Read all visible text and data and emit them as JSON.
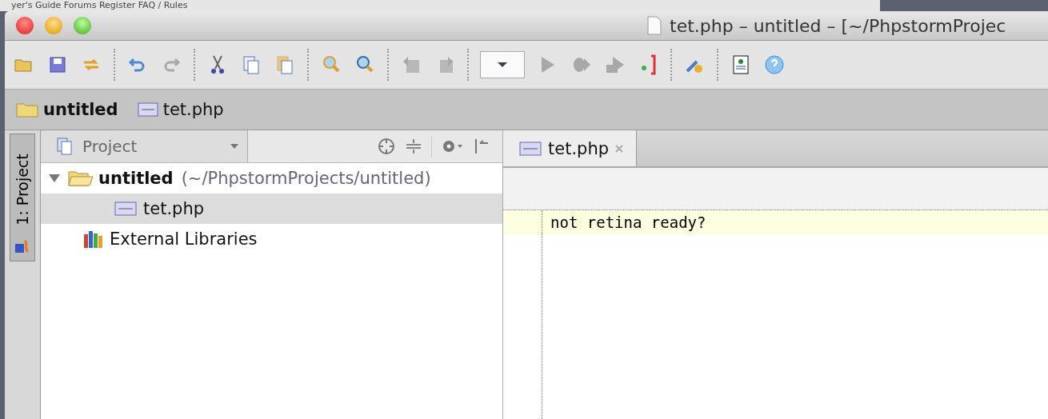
{
  "backdrop_text": "yer's Guide Forums Register FAQ / Rules",
  "window": {
    "title": "tet.php – untitled – [~/PhpstormProjec"
  },
  "toolbar": {
    "groups": [
      [
        {
          "kind": "open",
          "disabled": false
        },
        {
          "kind": "save",
          "disabled": false
        },
        {
          "kind": "sync",
          "disabled": false
        }
      ],
      [
        {
          "kind": "undo",
          "disabled": false
        },
        {
          "kind": "redo",
          "disabled": true
        }
      ],
      [
        {
          "kind": "cut",
          "disabled": false
        },
        {
          "kind": "copy",
          "disabled": false
        },
        {
          "kind": "paste",
          "disabled": false
        }
      ],
      [
        {
          "kind": "find",
          "disabled": false
        },
        {
          "kind": "replace",
          "disabled": false
        }
      ],
      [
        {
          "kind": "back",
          "disabled": true
        },
        {
          "kind": "forward",
          "disabled": true
        }
      ],
      [
        {
          "kind": "config",
          "disabled": false
        },
        {
          "kind": "run",
          "disabled": true
        },
        {
          "kind": "debug",
          "disabled": true
        },
        {
          "kind": "coverage",
          "disabled": true
        },
        {
          "kind": "listen",
          "disabled": false
        }
      ],
      [
        {
          "kind": "settings",
          "disabled": false
        }
      ],
      [
        {
          "kind": "web",
          "disabled": false
        },
        {
          "kind": "help",
          "disabled": false
        }
      ]
    ]
  },
  "breadcrumbs": [
    {
      "kind": "folder",
      "label": "untitled"
    },
    {
      "kind": "php",
      "label": "tet.php"
    }
  ],
  "side_tab": {
    "label": "1: Project",
    "selected": true
  },
  "project_panel": {
    "view": "Project",
    "tree": [
      {
        "kind": "folder",
        "label": "untitled",
        "path": "(~/PhpstormProjects/untitled)",
        "expanded": true,
        "selected": false,
        "children": [
          {
            "kind": "php",
            "label": "tet.php",
            "selected": true
          }
        ]
      },
      {
        "kind": "libraries",
        "label": "External Libraries",
        "selected": false
      }
    ]
  },
  "editor": {
    "tabs": [
      {
        "label": "tet.php",
        "selected": true
      }
    ],
    "lines": [
      {
        "text": "not retina ready?",
        "current": true
      }
    ]
  }
}
